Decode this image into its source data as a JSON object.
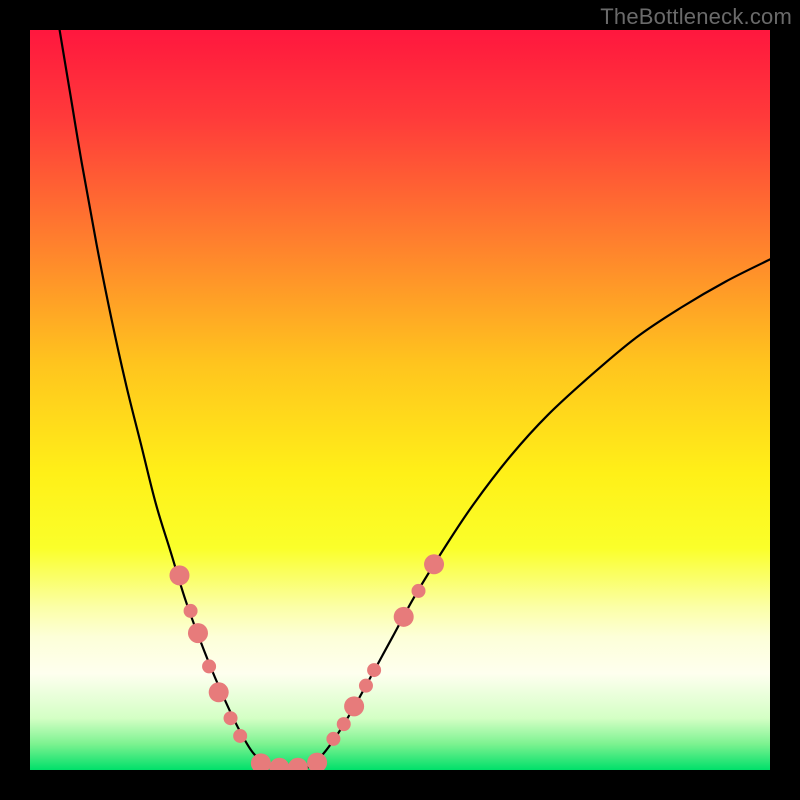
{
  "watermark": "TheBottleneck.com",
  "chart_data": {
    "type": "line",
    "title": "",
    "xlabel": "",
    "ylabel": "",
    "xlim": [
      0,
      100
    ],
    "ylim": [
      0,
      100
    ],
    "grid": false,
    "legend": false,
    "background_gradient_stops": [
      {
        "offset": 0.0,
        "color": "#ff173e"
      },
      {
        "offset": 0.12,
        "color": "#ff3b3a"
      },
      {
        "offset": 0.28,
        "color": "#ff7d2e"
      },
      {
        "offset": 0.45,
        "color": "#ffc41e"
      },
      {
        "offset": 0.6,
        "color": "#fff018"
      },
      {
        "offset": 0.7,
        "color": "#faff2a"
      },
      {
        "offset": 0.78,
        "color": "#fbffa7"
      },
      {
        "offset": 0.82,
        "color": "#fdffd8"
      },
      {
        "offset": 0.87,
        "color": "#feffef"
      },
      {
        "offset": 0.93,
        "color": "#d4ffc5"
      },
      {
        "offset": 0.965,
        "color": "#7cf290"
      },
      {
        "offset": 1.0,
        "color": "#00e06a"
      }
    ],
    "series": [
      {
        "name": "bottleneck-curve-left",
        "stroke": "#000000",
        "points": [
          {
            "x": 4.0,
            "y": 100.0
          },
          {
            "x": 5.5,
            "y": 91.0
          },
          {
            "x": 7.0,
            "y": 82.0
          },
          {
            "x": 9.0,
            "y": 71.0
          },
          {
            "x": 11.0,
            "y": 61.0
          },
          {
            "x": 13.0,
            "y": 52.0
          },
          {
            "x": 15.0,
            "y": 44.0
          },
          {
            "x": 17.0,
            "y": 36.0
          },
          {
            "x": 19.0,
            "y": 29.5
          },
          {
            "x": 21.0,
            "y": 23.0
          },
          {
            "x": 23.0,
            "y": 17.5
          },
          {
            "x": 25.0,
            "y": 12.5
          },
          {
            "x": 27.0,
            "y": 8.0
          },
          {
            "x": 28.5,
            "y": 5.0
          },
          {
            "x": 30.0,
            "y": 2.5
          },
          {
            "x": 31.5,
            "y": 1.0
          },
          {
            "x": 33.0,
            "y": 0.2
          }
        ]
      },
      {
        "name": "bottleneck-flat",
        "stroke": "#000000",
        "points": [
          {
            "x": 33.0,
            "y": 0.2
          },
          {
            "x": 37.0,
            "y": 0.2
          }
        ]
      },
      {
        "name": "bottleneck-curve-right",
        "stroke": "#000000",
        "points": [
          {
            "x": 37.0,
            "y": 0.2
          },
          {
            "x": 39.0,
            "y": 1.5
          },
          {
            "x": 41.0,
            "y": 4.0
          },
          {
            "x": 43.5,
            "y": 8.0
          },
          {
            "x": 46.0,
            "y": 12.5
          },
          {
            "x": 49.0,
            "y": 18.0
          },
          {
            "x": 52.0,
            "y": 23.5
          },
          {
            "x": 56.0,
            "y": 30.0
          },
          {
            "x": 60.0,
            "y": 36.0
          },
          {
            "x": 65.0,
            "y": 42.5
          },
          {
            "x": 70.0,
            "y": 48.0
          },
          {
            "x": 76.0,
            "y": 53.5
          },
          {
            "x": 82.0,
            "y": 58.5
          },
          {
            "x": 88.0,
            "y": 62.5
          },
          {
            "x": 94.0,
            "y": 66.0
          },
          {
            "x": 100.0,
            "y": 69.0
          }
        ]
      }
    ],
    "markers": {
      "name": "highlighted-points",
      "fill": "#e77b7b",
      "stroke": "#c95c5c",
      "radius_primary": 10,
      "radius_secondary": 7,
      "points": [
        {
          "x": 20.2,
          "y": 26.3,
          "r": "primary"
        },
        {
          "x": 21.7,
          "y": 21.5,
          "r": "secondary"
        },
        {
          "x": 22.7,
          "y": 18.5,
          "r": "primary"
        },
        {
          "x": 24.2,
          "y": 14.0,
          "r": "secondary"
        },
        {
          "x": 25.5,
          "y": 10.5,
          "r": "primary"
        },
        {
          "x": 27.1,
          "y": 7.0,
          "r": "secondary"
        },
        {
          "x": 28.4,
          "y": 4.6,
          "r": "secondary"
        },
        {
          "x": 31.2,
          "y": 0.9,
          "r": "primary"
        },
        {
          "x": 33.7,
          "y": 0.3,
          "r": "primary"
        },
        {
          "x": 36.2,
          "y": 0.3,
          "r": "primary"
        },
        {
          "x": 38.8,
          "y": 1.0,
          "r": "primary"
        },
        {
          "x": 41.0,
          "y": 4.2,
          "r": "secondary"
        },
        {
          "x": 42.4,
          "y": 6.2,
          "r": "secondary"
        },
        {
          "x": 43.8,
          "y": 8.6,
          "r": "primary"
        },
        {
          "x": 45.4,
          "y": 11.4,
          "r": "secondary"
        },
        {
          "x": 46.5,
          "y": 13.5,
          "r": "secondary"
        },
        {
          "x": 50.5,
          "y": 20.7,
          "r": "primary"
        },
        {
          "x": 52.5,
          "y": 24.2,
          "r": "secondary"
        },
        {
          "x": 54.6,
          "y": 27.8,
          "r": "primary"
        }
      ]
    }
  }
}
